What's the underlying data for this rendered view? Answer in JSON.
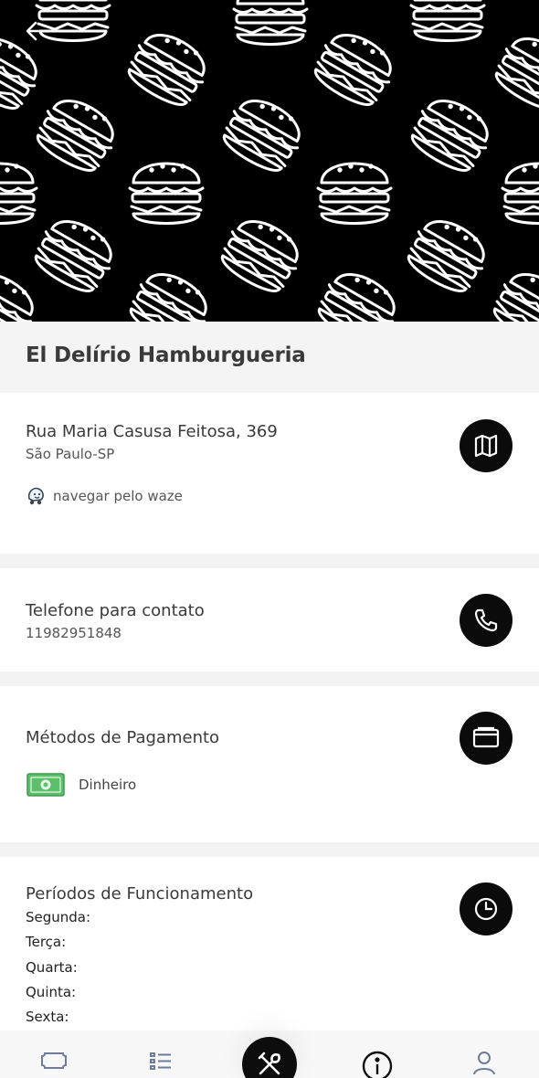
{
  "restaurant": {
    "name": "El Delírio Hamburgueria"
  },
  "address": {
    "street": "Rua Maria Casusa Feitosa, 369",
    "city": "São Paulo-SP",
    "waze_label": "navegar pelo waze",
    "map_icon": "map-icon"
  },
  "contact": {
    "title": "Telefone para contato",
    "phone": "11982951848",
    "phone_icon": "phone-icon"
  },
  "payment": {
    "title": "Métodos de Pagamento",
    "methods": [
      {
        "label": "Dinheiro",
        "icon": "cash-icon"
      }
    ],
    "card_icon": "wallet-icon"
  },
  "hours": {
    "title": "Períodos de Funcionamento",
    "days": [
      "Segunda:",
      "Terça:",
      "Quarta:",
      "Quinta:",
      "Sexta:"
    ],
    "clock_icon": "clock-icon"
  },
  "tabs": [
    "ticket-icon",
    "list-icon",
    "fork-knife-icon",
    "info-icon",
    "user-icon"
  ],
  "colors": {
    "dark": "#0b0b0b",
    "cash_green": "#5cbf6a",
    "background": "#f3f3f3"
  }
}
